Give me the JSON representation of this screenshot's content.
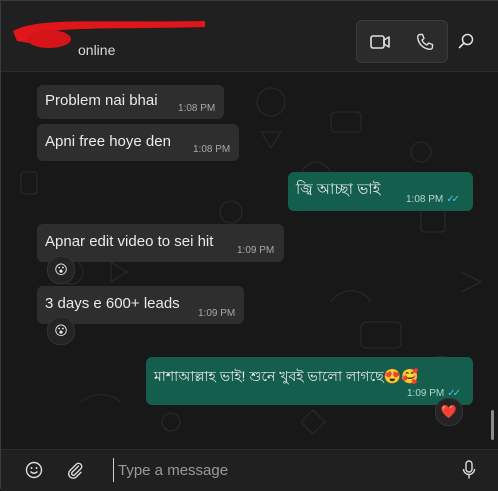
{
  "header": {
    "status": "online",
    "icons": {
      "video": "video-camera-icon",
      "call": "phone-icon",
      "search": "search-icon"
    }
  },
  "messages": [
    {
      "direction": "in",
      "text": "Problem nai bhai",
      "time": "1:08 PM"
    },
    {
      "direction": "in",
      "text": "Apni free hoye den",
      "time": "1:08 PM"
    },
    {
      "direction": "out",
      "text": "জ্বি আচ্ছা ভাই",
      "time": "1:08 PM",
      "ticks": "✓✓"
    },
    {
      "direction": "in",
      "text": "Apnar edit video to sei hit",
      "time": "1:09 PM",
      "reaction": "😮"
    },
    {
      "direction": "in",
      "text": "3 days e 600+ leads",
      "time": "1:09 PM",
      "reaction": "😮"
    },
    {
      "direction": "out",
      "text": "মাশাআল্লাহ ভাই! শুনে খুবই ভালো লাগছে😍🥰",
      "time": "1:09 PM",
      "ticks": "✓✓",
      "reaction": "❤️"
    }
  ],
  "composer": {
    "placeholder": "Type a message",
    "icons": {
      "emoji": "emoji-icon",
      "attach": "paperclip-icon",
      "mic": "microphone-icon"
    }
  },
  "colors": {
    "incoming_bubble": "#2e2e2e",
    "outgoing_bubble": "#135e4c",
    "read_ticks": "#53bdeb",
    "background": "#181818"
  }
}
